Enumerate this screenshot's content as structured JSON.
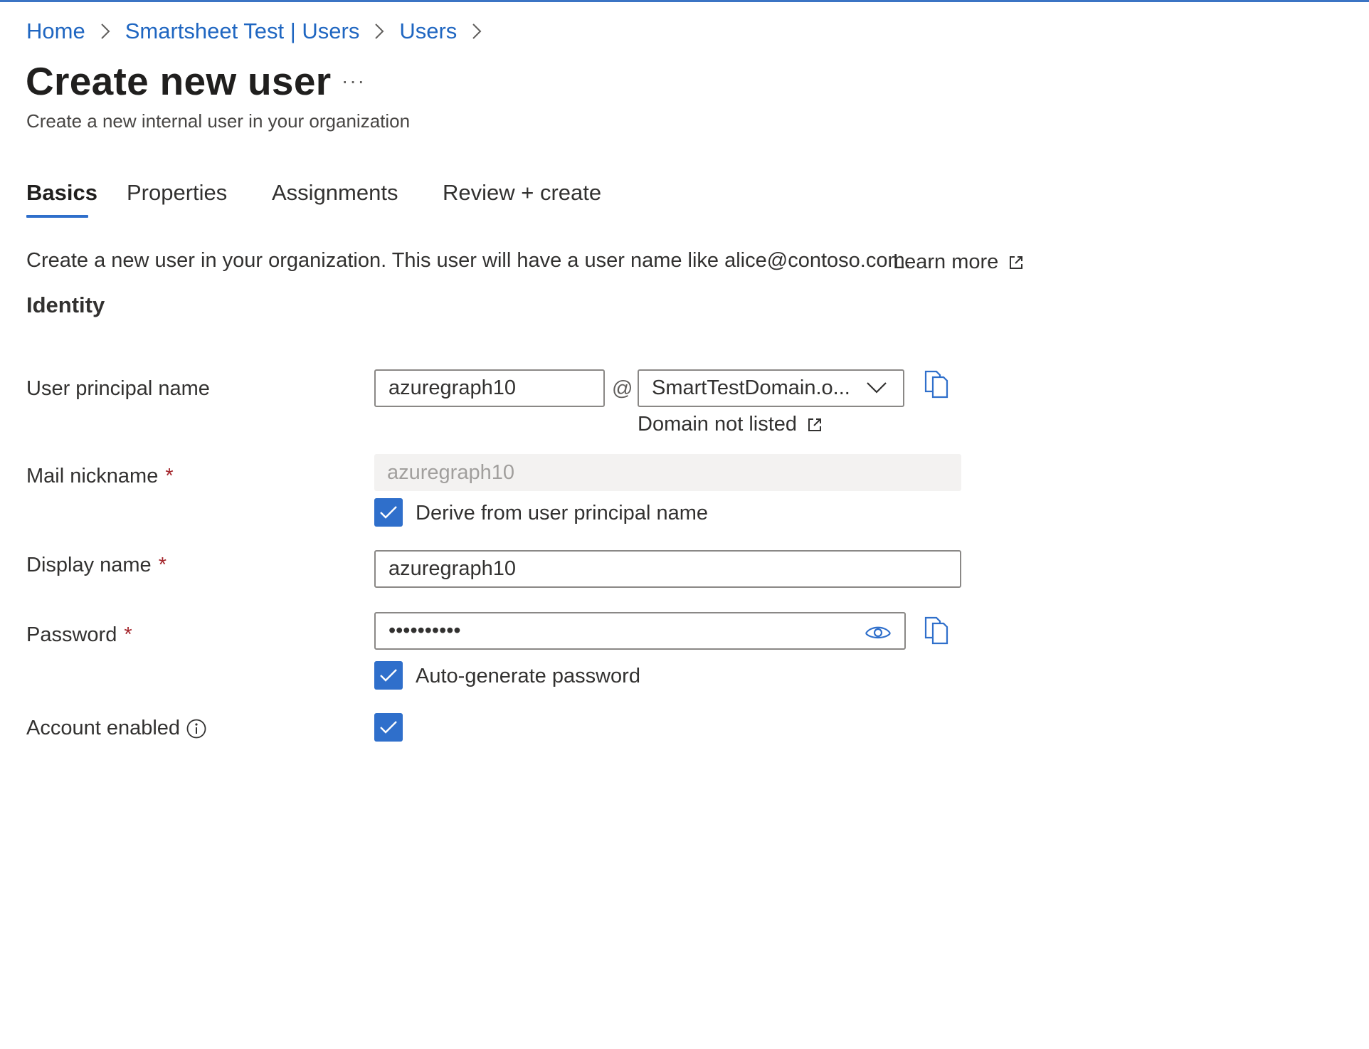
{
  "breadcrumb": [
    "Home",
    "Smartsheet Test | Users",
    "Users"
  ],
  "page": {
    "title": "Create new user",
    "more": "···",
    "subtitle": "Create a new internal user in your organization"
  },
  "tabs": [
    "Basics",
    "Properties",
    "Assignments",
    "Review + create"
  ],
  "active_tab": "Basics",
  "intro": {
    "text": "Create a new user in your organization. This user will have a user name like alice@contoso.com.",
    "learn_more": "Learn more"
  },
  "section_title": "Identity",
  "form": {
    "upn_label": "User principal name",
    "upn_value": "azuregraph10",
    "at": "@",
    "domain_value": "SmartTestDomain.o...",
    "domain_not_listed": "Domain not listed",
    "mail_nickname_label": "Mail nickname",
    "mail_nickname_value": "azuregraph10",
    "derive_label": "Derive from user principal name",
    "display_name_label": "Display name",
    "display_name_value": "azuregraph10",
    "password_label": "Password",
    "password_value": "••••••••••",
    "autogen_label": "Auto-generate password",
    "account_enabled_label": "Account enabled",
    "required_mark": "*"
  },
  "colors": {
    "accent": "#2f6fcb",
    "link": "#1f66c1",
    "required": "#a4262c"
  },
  "icons": [
    "chevron-right-icon",
    "external-link-icon",
    "chevron-down-icon",
    "copy-icon",
    "eye-icon",
    "checkmark-icon",
    "info-icon"
  ]
}
